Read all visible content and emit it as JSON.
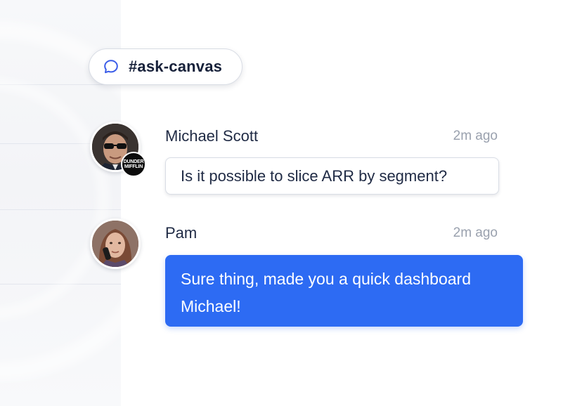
{
  "channel": {
    "name": "#ask-canvas",
    "icon": "chat-bubble-icon",
    "icon_color": "#3a5ce8"
  },
  "messages": [
    {
      "author": "Michael Scott",
      "time": "2m ago",
      "text": "Is it possible to slice ARR by segment?",
      "avatar": "michael-avatar",
      "badge": {
        "icon": "dunder-mifflin-logo",
        "lines": [
          "DUNDER",
          "MIFFLIN"
        ]
      },
      "style": "incoming"
    },
    {
      "author": "Pam",
      "time": "2m ago",
      "text": "Sure thing, made you a quick dashboard Michael!",
      "avatar": "pam-avatar",
      "style": "outgoing"
    }
  ],
  "colors": {
    "accent": "#2d6bf3",
    "text": "#1f2a44",
    "muted": "#9aa1ae",
    "border": "#d9dde5"
  }
}
